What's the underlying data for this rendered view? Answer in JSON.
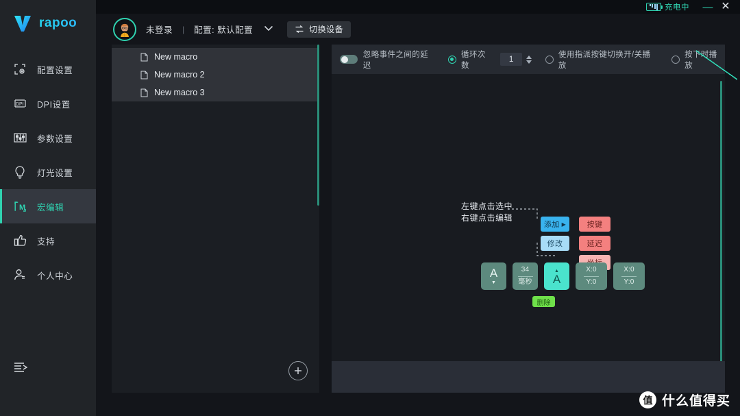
{
  "titlebar": {
    "battery_label": "充电中",
    "minimize_label": "—",
    "close_label": "✕"
  },
  "brand": {
    "name": "rapoo"
  },
  "sidebar": {
    "items": [
      {
        "icon": "config-frame-icon",
        "label": "配置设置",
        "active": false
      },
      {
        "icon": "dpi-icon",
        "label": "DPI设置",
        "active": false
      },
      {
        "icon": "sliders-icon",
        "label": "参数设置",
        "active": false
      },
      {
        "icon": "lightbulb-icon",
        "label": "灯光设置",
        "active": false
      },
      {
        "icon": "macro-m-icon",
        "label": "宏编辑",
        "active": true
      },
      {
        "icon": "thumbs-up-icon",
        "label": "支持",
        "active": false
      },
      {
        "icon": "user-icon",
        "label": "个人中心",
        "active": false
      }
    ],
    "collapse_icon": "collapse-arrow-icon"
  },
  "header": {
    "avatar": "user-avatar",
    "user_status": "未登录",
    "separator": "|",
    "profile_label": "配置: 默认配置",
    "caret_icon": "chevron-down-icon",
    "switch_device_label": "切换设备",
    "switch_device_icon": "switch-icon"
  },
  "macro_list": {
    "items": [
      {
        "icon": "document-icon",
        "name": "New macro"
      },
      {
        "icon": "document-icon",
        "name": "New macro 2"
      },
      {
        "icon": "document-icon",
        "name": "New macro 3"
      }
    ],
    "add_button_label": "+",
    "add_button_icon": "plus-circle-icon"
  },
  "toolbar": {
    "ignore_delay_label": "忽略事件之间的延迟",
    "ignore_delay_on": false,
    "loop_count_label": "循环次数",
    "loop_count_selected": true,
    "loop_count_value": "1",
    "spinner_icon": "spinner-up-down-icon",
    "toggle_playback_label": "使用指派按键切换开/关播放",
    "toggle_playback_selected": false,
    "press_to_play_label": "按下时播放",
    "press_to_play_selected": false
  },
  "diagram": {
    "hint_text": "左键点击选中\n右键点击编辑",
    "context_menu": [
      {
        "label": "添加",
        "style": "blue",
        "arrow": "▶"
      },
      {
        "label": "按键",
        "style": "red",
        "arrow": ""
      },
      {
        "label": "修改",
        "style": "blue-l",
        "arrow": ""
      },
      {
        "label": "延迟",
        "style": "red",
        "arrow": ""
      },
      {
        "label": "坐标",
        "style": "red-l",
        "arrow": ""
      }
    ],
    "menu_left": [
      {
        "label": "添加",
        "style": "blue",
        "arrow": "▶"
      },
      {
        "label": "修改",
        "style": "blue-l",
        "arrow": ""
      }
    ],
    "menu_right": [
      {
        "label": "按键",
        "style": "red"
      },
      {
        "label": "延迟",
        "style": "red"
      },
      {
        "label": "坐标",
        "style": "red-l"
      }
    ],
    "event_cards": [
      {
        "type": "key-up",
        "glyph": "A",
        "sub": "▼",
        "selected": false
      },
      {
        "type": "delay",
        "top": "34",
        "bottom": "毫秒",
        "selected": false
      },
      {
        "type": "key-down",
        "glyph": "A",
        "sub": "▲",
        "selected": true
      },
      {
        "type": "coordinate",
        "top": "X:0",
        "bottom": "Y:0",
        "selected": false
      },
      {
        "type": "coordinate",
        "top": "X:0",
        "bottom": "Y:0",
        "selected": false
      }
    ],
    "delete_label": "删除"
  },
  "watermark": {
    "badge": "值",
    "text": "什么值得买"
  }
}
